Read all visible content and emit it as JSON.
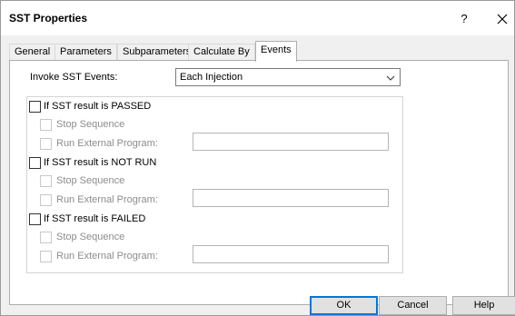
{
  "window": {
    "title": "SST Properties",
    "help": "?",
    "close_icon": "close-icon"
  },
  "tabs": [
    {
      "label": "General",
      "active": false
    },
    {
      "label": "Parameters",
      "active": false
    },
    {
      "label": "Subparameters",
      "active": false
    },
    {
      "label": "Calculate By",
      "active": false
    },
    {
      "label": "Events",
      "active": true
    }
  ],
  "invoke": {
    "label": "Invoke SST Events:",
    "value": "Each Injection"
  },
  "groups": [
    {
      "title": "If SST result is PASSED",
      "stop_label": "Stop Sequence",
      "run_label": "Run External Program:",
      "run_value": ""
    },
    {
      "title": "If SST result is NOT RUN",
      "stop_label": "Stop Sequence",
      "run_label": "Run External Program:",
      "run_value": ""
    },
    {
      "title": "If SST result is FAILED",
      "stop_label": "Stop Sequence",
      "run_label": "Run External Program:",
      "run_value": ""
    }
  ],
  "buttons": {
    "ok": "OK",
    "cancel": "Cancel",
    "help": "Help"
  }
}
